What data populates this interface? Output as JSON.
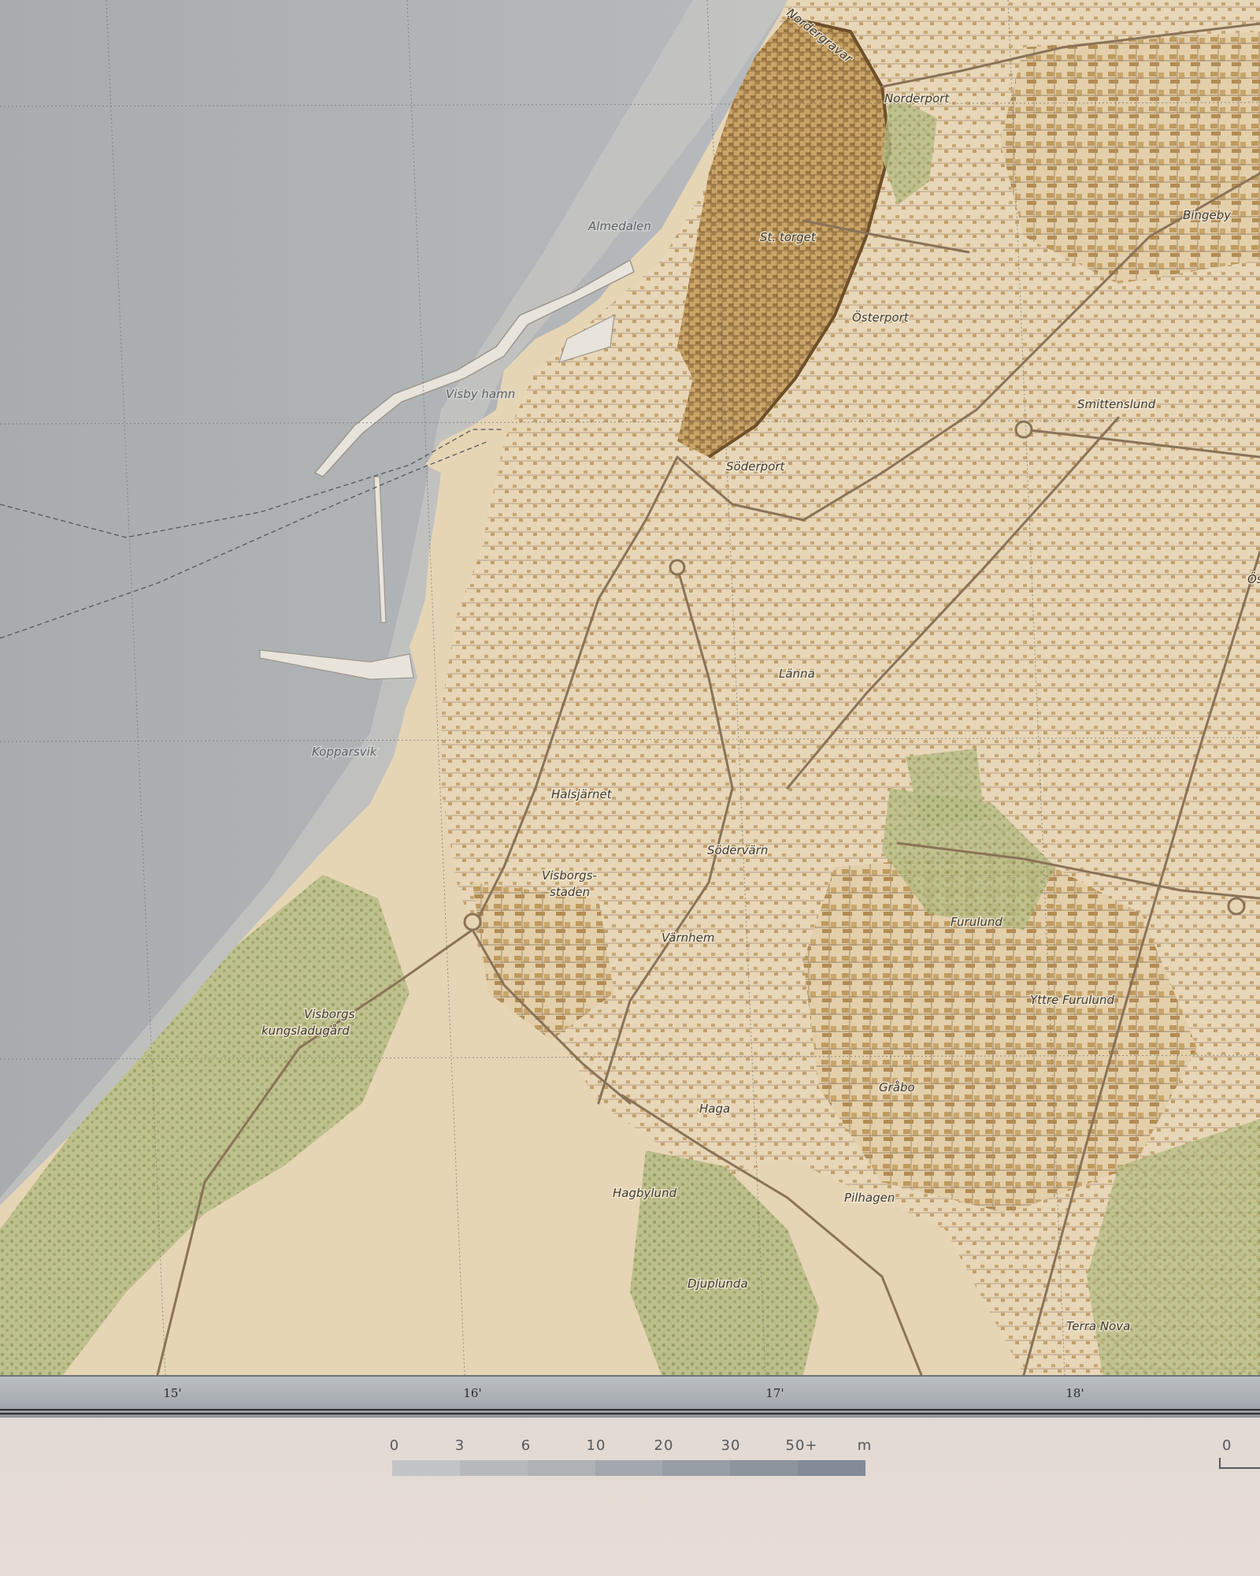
{
  "map": {
    "places": [
      {
        "name": "Nordergravar"
      },
      {
        "name": "Norderport"
      },
      {
        "name": "Bingeby"
      },
      {
        "name": "Almedalen"
      },
      {
        "name": "St. torget"
      },
      {
        "name": "Österport"
      },
      {
        "name": "Visby hamn"
      },
      {
        "name": "Smittenslund"
      },
      {
        "name": "Söderport"
      },
      {
        "name": "Ös"
      },
      {
        "name": "Länna"
      },
      {
        "name": "Kopparsvik"
      },
      {
        "name": "Halsjärnet"
      },
      {
        "name": "Södervärn"
      },
      {
        "name": "Visborgs-"
      },
      {
        "name": "staden"
      },
      {
        "name": "Furulund"
      },
      {
        "name": "Värnhem"
      },
      {
        "name": "Yttre Furulund"
      },
      {
        "name": "Visborgs"
      },
      {
        "name": "kungsladugård"
      },
      {
        "name": "Gråbo"
      },
      {
        "name": "Haga"
      },
      {
        "name": "Hagbylund"
      },
      {
        "name": "Pilhagen"
      },
      {
        "name": "Djuplunda"
      },
      {
        "name": "Terra Nova"
      }
    ],
    "colors": {
      "sea": "#b8bbbd",
      "land": "#e6d5b5",
      "urban": "#d9c29a",
      "forest": "#b3b981",
      "building": "#b68e51",
      "road": "#8a7358"
    }
  },
  "graticule": {
    "ticks": [
      "15'",
      "16'",
      "17'",
      "18'"
    ]
  },
  "depth_legend": {
    "labels": [
      "0",
      "3",
      "6",
      "10",
      "20",
      "30",
      "50+",
      "m"
    ],
    "colors": [
      "#c2c4c6",
      "#b7babd",
      "#aeb2b6",
      "#a3a8ae",
      "#989ea6",
      "#8d949d",
      "#818a95"
    ]
  },
  "scale_bar": {
    "zero_label": "0"
  }
}
